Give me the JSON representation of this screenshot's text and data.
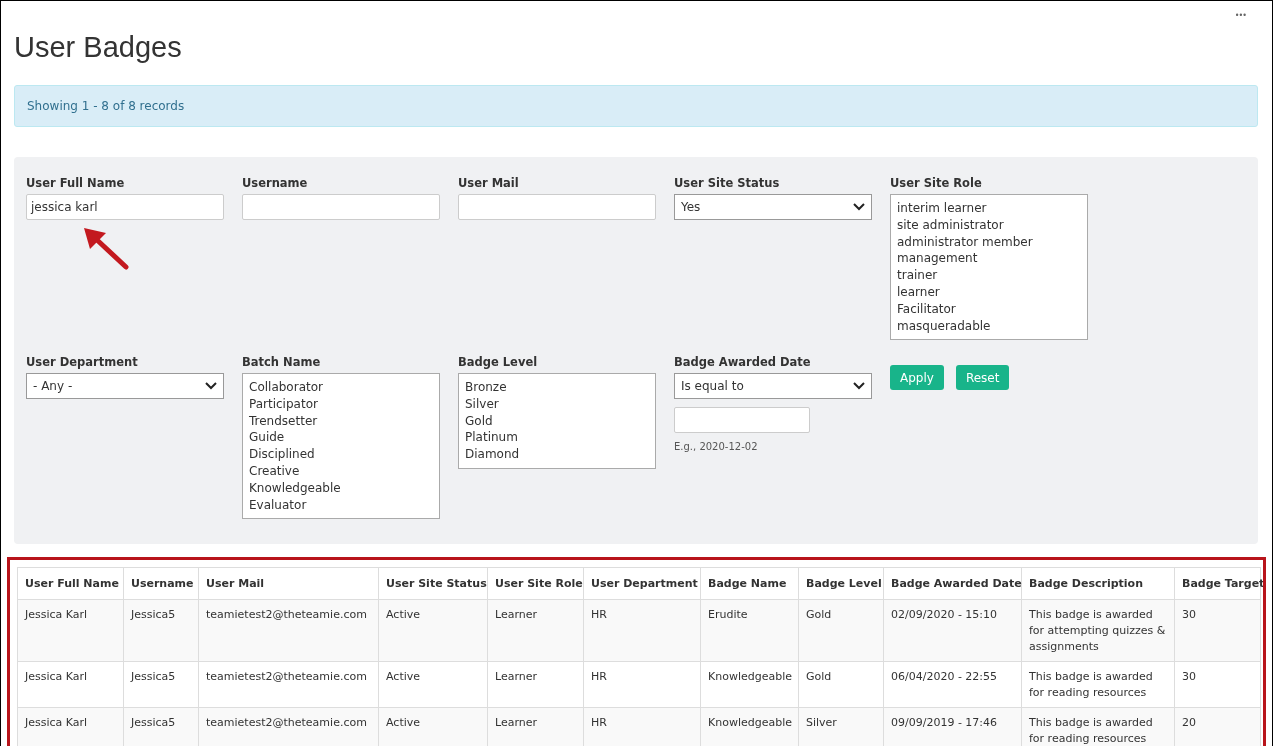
{
  "title": "User Badges",
  "more_menu": "•••",
  "record_info": "Showing 1 - 8 of 8 records",
  "filters": [
    {
      "kind": "text",
      "label": "User Full Name",
      "value": "jessica karl"
    },
    {
      "kind": "text",
      "label": "Username"
    },
    {
      "kind": "text",
      "label": "User Mail"
    },
    {
      "kind": "select",
      "label": "User Site Status",
      "value": "Yes"
    },
    {
      "kind": "listbox",
      "label": "User Site Role",
      "options": [
        "interim learner",
        "site administrator",
        "administrator member",
        "management",
        "trainer",
        "learner",
        "Facilitator",
        "masqueradable"
      ]
    },
    {
      "kind": "select",
      "label": "User Department",
      "value": "- Any -"
    },
    {
      "kind": "listbox",
      "label": "Batch Name",
      "options": [
        "Collaborator",
        "Participator",
        "Trendsetter",
        "Guide",
        "Disciplined",
        "Creative",
        "Knowledgeable",
        "Evaluator"
      ]
    },
    {
      "kind": "listbox",
      "label": "Badge Level",
      "options": [
        "Bronze",
        "Silver",
        "Gold",
        "Platinum",
        "Diamond"
      ]
    },
    {
      "kind": "date",
      "label": "Badge Awarded Date",
      "operator": "Is equal to",
      "hint": "E.g., 2020-12-02"
    }
  ],
  "buttons": [
    "Apply",
    "Reset"
  ],
  "table": {
    "columns": [
      "User Full Name",
      "Username",
      "User Mail",
      "User Site Status",
      "User Site Role",
      "User Department",
      "Badge Name",
      "Badge Level",
      "Badge Awarded Date",
      "Badge Description",
      "Badge Target"
    ],
    "rows": [
      [
        "Jessica Karl",
        "Jessica5",
        "teamietest2@theteamie.com",
        "Active",
        "Learner",
        "HR",
        "Erudite",
        "Gold",
        "02/09/2020 - 15:10",
        "This badge is awarded for attempting quizzes & assignments",
        "30"
      ],
      [
        "Jessica Karl",
        "Jessica5",
        "teamietest2@theteamie.com",
        "Active",
        "Learner",
        "HR",
        "Knowledgeable",
        "Gold",
        "06/04/2020 - 22:55",
        "This badge is awarded for reading resources",
        "30"
      ],
      [
        "Jessica Karl",
        "Jessica5",
        "teamietest2@theteamie.com",
        "Active",
        "Learner",
        "HR",
        "Knowledgeable",
        "Silver",
        "09/09/2019 - 17:46",
        "This badge is awarded for reading resources",
        "20"
      ]
    ]
  }
}
